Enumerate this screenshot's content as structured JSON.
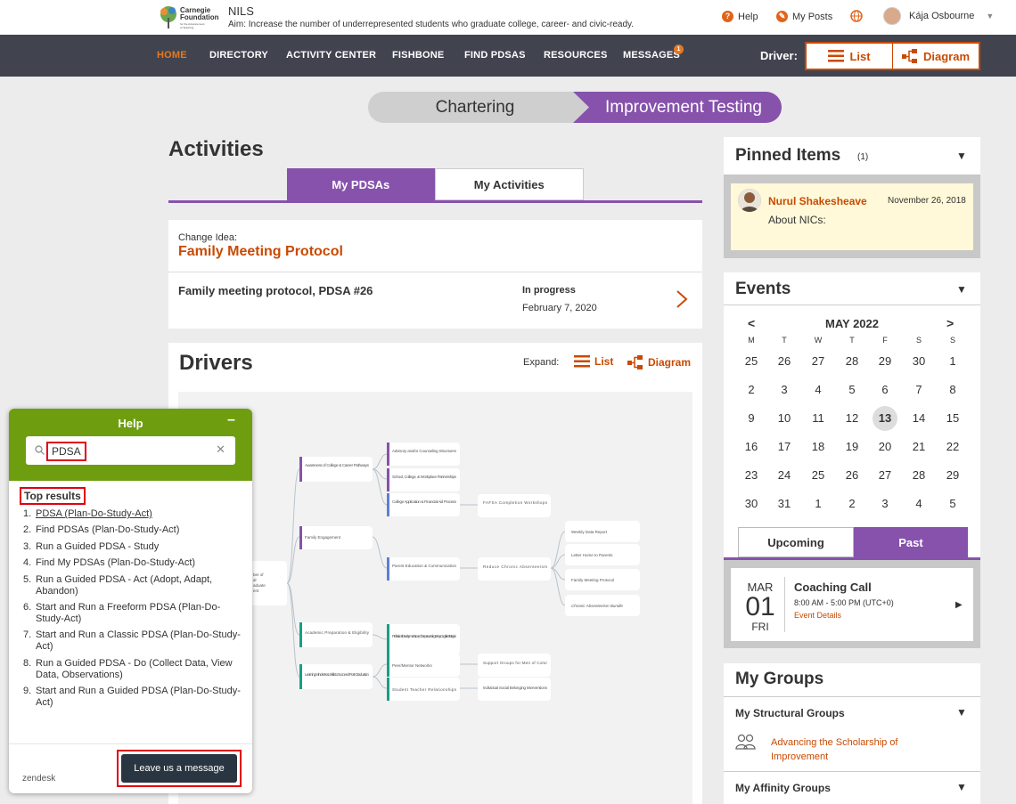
{
  "header": {
    "logo_text": "Carnegie Foundation for the Advancement of Teaching",
    "app_name": "NILS",
    "aim": "Aim: Increase the number of underrepresented students who graduate college, career- and civic-ready.",
    "help": "Help",
    "my_posts": "My Posts",
    "user_name": "Kája Osbourne"
  },
  "nav": {
    "items": [
      "HOME",
      "DIRECTORY",
      "ACTIVITY CENTER",
      "FISHBONE",
      "FIND PDSAS",
      "RESOURCES",
      "MESSAGES"
    ],
    "messages_badge": "1",
    "driver_label": "Driver:",
    "list_label": "List",
    "diagram_label": "Diagram"
  },
  "phases": {
    "chartering": "Chartering",
    "improvement": "Improvement Testing"
  },
  "activities": {
    "title": "Activities",
    "tab_pdsas": "My PDSAs",
    "tab_activities": "My Activities",
    "change_idea_label": "Change Idea:",
    "change_idea_title": "Family Meeting Protocol",
    "pdsa_name": "Family meeting protocol, PDSA #26",
    "pdsa_status": "In progress",
    "pdsa_date": "February 7, 2020"
  },
  "drivers": {
    "title": "Drivers",
    "expand_label": "Expand:",
    "list_label": "List",
    "diagram_label": "Diagram",
    "root_fragment": [
      "ber of",
      "al",
      "aduate",
      "ent"
    ],
    "primary": [
      "Awareness of College & Career Pathways",
      "Family Engagement",
      "Academic Preparation & Eligibility",
      "Learning Mindsets & Skills to Succeed Post Graduation"
    ],
    "secondary": [
      "Advisory and/or Counseling Structures",
      "School, College, & Workplace Partnerships",
      "College Application & Financial Aid Process",
      "Parent Education & Communication",
      "Professional Development around Deeper Learning & Key Cognitive Strategies",
      "Peer/Mentor Networks",
      "Student Teacher Relationships"
    ],
    "change_ideas": [
      "FAFSA Completion Workshops",
      "Reduce Chronic Absenteeism",
      "Support Groups for Men of Color",
      "Individual Social Belonging Interventions"
    ],
    "tertiary": [
      "Weekly Data Report",
      "Letter Home to Parents",
      "Family Meeting Protocol",
      "Chronic Absenteeism Bundle"
    ]
  },
  "pinned": {
    "title": "Pinned Items",
    "count": "(1)",
    "user": "Nurul Shakesheave",
    "date": "November 26, 2018",
    "text": "About NICs:"
  },
  "events": {
    "title": "Events",
    "month": "MAY 2022",
    "prev": "<",
    "next": ">",
    "dow": [
      "M",
      "T",
      "W",
      "T",
      "F",
      "S",
      "S"
    ],
    "weeks": [
      [
        "25",
        "26",
        "27",
        "28",
        "29",
        "30",
        "1"
      ],
      [
        "2",
        "3",
        "4",
        "5",
        "6",
        "7",
        "8"
      ],
      [
        "9",
        "10",
        "11",
        "12",
        "13",
        "14",
        "15"
      ],
      [
        "16",
        "17",
        "18",
        "19",
        "20",
        "21",
        "22"
      ],
      [
        "23",
        "24",
        "25",
        "26",
        "27",
        "28",
        "29"
      ],
      [
        "30",
        "31",
        "1",
        "2",
        "3",
        "4",
        "5"
      ]
    ],
    "today": "13",
    "tab_upcoming": "Upcoming",
    "tab_past": "Past",
    "item": {
      "month": "MAR",
      "day": "01",
      "dow": "FRI",
      "title": "Coaching Call",
      "time": "8:00 AM - 5:00 PM (UTC+0)",
      "link": "Event Details"
    }
  },
  "groups": {
    "title": "My Groups",
    "structural": "My Structural Groups",
    "structural_item": "Advancing the Scholarship of Improvement",
    "affinity": "My Affinity Groups"
  },
  "help_widget": {
    "title": "Help",
    "minimize": "–",
    "query": "PDSA",
    "top_results": "Top results",
    "results": [
      "PDSA (Plan-Do-Study-Act)",
      "Find PDSAs (Plan-Do-Study-Act)",
      "Run a Guided PDSA - Study",
      "Find My PDSAs (Plan-Do-Study-Act)",
      "Run a Guided PDSA - Act (Adopt, Adapt, Abandon)",
      "Start and Run a Freeform PDSA (Plan-Do-Study-Act)",
      "Start and Run a Classic PDSA (Plan-Do-Study-Act)",
      "Run a Guided PDSA - Do (Collect Data, View Data, Observations)",
      "Start and Run a Guided PDSA (Plan-Do-Study-Act)"
    ],
    "footer_brand": "zendesk",
    "leave_message": "Leave us a message"
  },
  "colors": {
    "accent": "#c94a02",
    "purple": "#8652ab",
    "nav_bg": "#41444f",
    "help_green": "#6e9e0f"
  }
}
